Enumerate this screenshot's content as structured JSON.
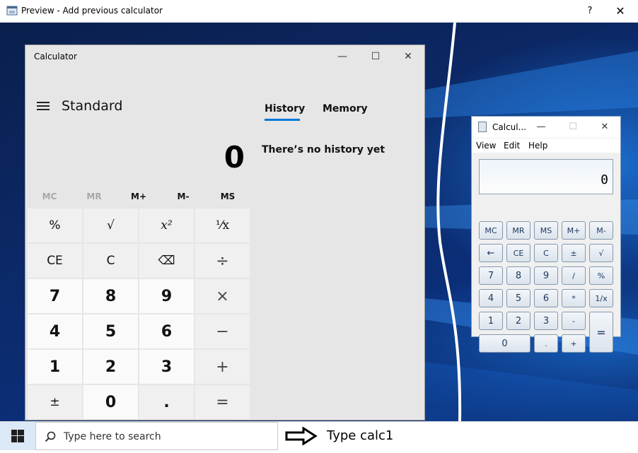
{
  "window": {
    "title": "Preview - Add previous calculator",
    "help": "?",
    "close": "✕"
  },
  "calc10": {
    "title": "Calculator",
    "minimize": "—",
    "maximize": "☐",
    "close": "✕",
    "mode": "Standard",
    "tabs": [
      "History",
      "Memory"
    ],
    "display": "0",
    "history_empty": "There’s no history yet",
    "memory": [
      "MC",
      "MR",
      "M+",
      "M-",
      "MS"
    ],
    "keys": [
      [
        "%",
        "√",
        "x²",
        "⅟x"
      ],
      [
        "CE",
        "C",
        "⌫",
        "÷"
      ],
      [
        "7",
        "8",
        "9",
        "×"
      ],
      [
        "4",
        "5",
        "6",
        "−"
      ],
      [
        "1",
        "2",
        "3",
        "+"
      ],
      [
        "±",
        "0",
        ".",
        "="
      ]
    ]
  },
  "calc7": {
    "title": "Calcul...",
    "minimize": "—",
    "maximize": "☐",
    "close": "✕",
    "menu": [
      "View",
      "Edit",
      "Help"
    ],
    "display": "0",
    "rows": [
      [
        "MC",
        "MR",
        "MS",
        "M+",
        "M-"
      ],
      [
        "←",
        "CE",
        "C",
        "±",
        "√"
      ],
      [
        "7",
        "8",
        "9",
        "/",
        "%"
      ],
      [
        "4",
        "5",
        "6",
        "*",
        "1/x"
      ],
      [
        "1",
        "2",
        "3",
        "-",
        "="
      ],
      [
        "0",
        ".",
        "+"
      ]
    ]
  },
  "taskbar": {
    "search_placeholder": "Type here to search",
    "instruction": "Type calc1"
  }
}
